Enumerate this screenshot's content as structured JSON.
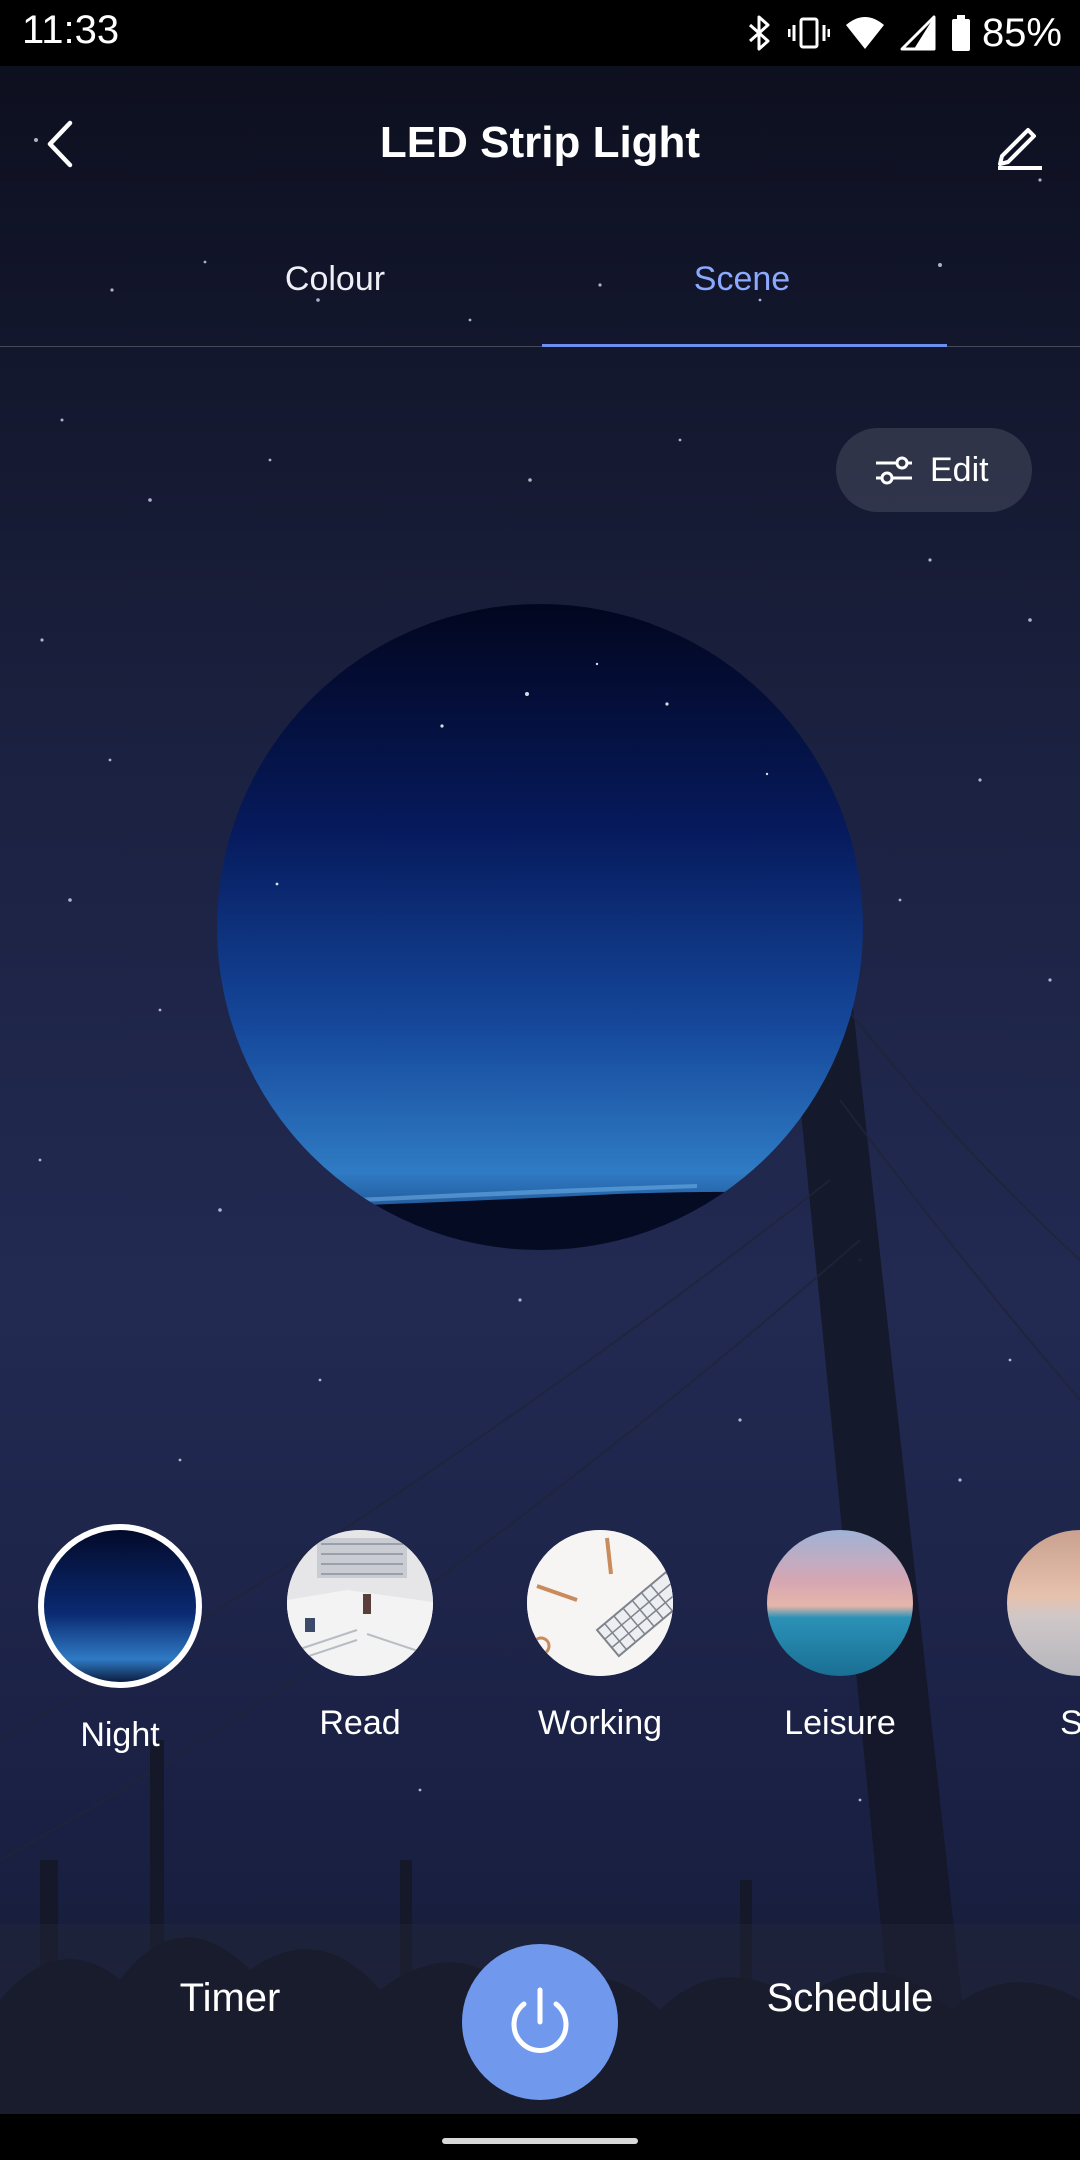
{
  "status_bar": {
    "time": "11:33",
    "battery": "85%",
    "icons": [
      "bluetooth-icon",
      "vibrate-icon",
      "wifi-icon",
      "signal-icon",
      "battery-icon"
    ]
  },
  "header": {
    "title": "LED Strip Light",
    "back_icon": "chevron-left-icon",
    "edit_icon": "pencil-icon"
  },
  "tabs": [
    {
      "label": "Colour",
      "selected": false
    },
    {
      "label": "Scene",
      "selected": true
    }
  ],
  "edit_chip": {
    "label": "Edit",
    "icon": "sliders-icon"
  },
  "scenes": [
    {
      "label": "Night",
      "selected": true
    },
    {
      "label": "Read",
      "selected": false
    },
    {
      "label": "Working",
      "selected": false
    },
    {
      "label": "Leisure",
      "selected": false
    },
    {
      "label": "Sc",
      "selected": false
    }
  ],
  "bottom_bar": {
    "timer_label": "Timer",
    "schedule_label": "Schedule",
    "power_icon": "power-icon"
  },
  "colors": {
    "accent": "#7099ee",
    "tab_active": "#8aa9ff"
  }
}
